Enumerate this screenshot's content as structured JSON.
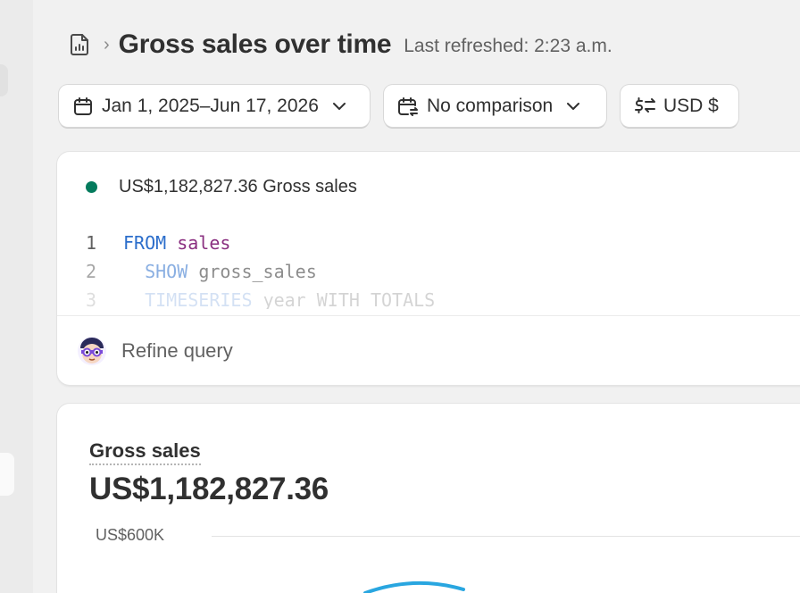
{
  "header": {
    "title": "Gross sales over time",
    "last_refreshed": "Last refreshed: 2:23 a.m."
  },
  "filters": {
    "date_range": "Jan 1, 2025–Jun 17, 2026",
    "comparison": "No comparison",
    "currency": "USD $"
  },
  "query": {
    "metric_summary": "US$1,182,827.36 Gross sales",
    "metric_color": "#047b5d",
    "lines": [
      {
        "num": "1",
        "keyword": "FROM",
        "rest": "sales"
      },
      {
        "num": "2",
        "keyword": "SHOW",
        "rest": "gross_sales"
      },
      {
        "num": "3",
        "keyword": "TIMESERIES",
        "rest": "year WITH TOTALS"
      }
    ],
    "refine_label": "Refine query"
  },
  "chart": {
    "title": "Gross sales",
    "total": "US$1,182,827.36",
    "y_tick": "US$600K",
    "series_color": "#29a6e0"
  },
  "chart_data": {
    "type": "line",
    "title": "Gross sales",
    "y_ticks": [
      "US$600K"
    ],
    "series": [],
    "grid": true
  }
}
